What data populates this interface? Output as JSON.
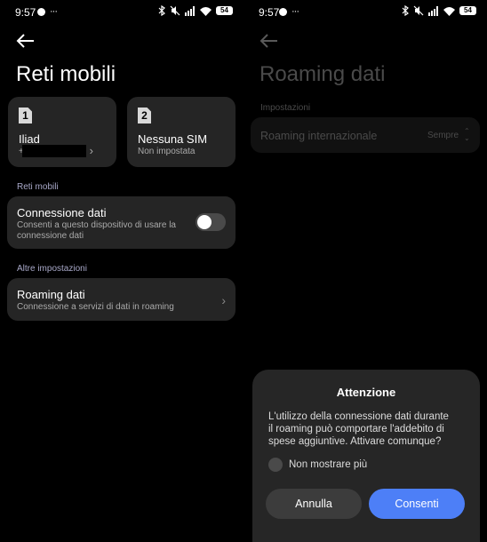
{
  "status": {
    "time": "9:57",
    "dots": "···",
    "battery": "54"
  },
  "left": {
    "title": "Reti mobili",
    "sims": [
      {
        "num": "1",
        "name": "Iliad",
        "sub": "+",
        "chevron": "›"
      },
      {
        "num": "2",
        "name": "Nessuna SIM",
        "sub": "Non impostata"
      }
    ],
    "section1": "Reti mobili",
    "data_conn": {
      "title": "Connessione dati",
      "desc_line1": "Consenti a questo dispositivo di usare la",
      "desc_line2": "connessione dati"
    },
    "section2": "Altre impostazioni",
    "roaming": {
      "title": "Roaming dati",
      "desc": "Connessione a servizi di dati in roaming",
      "chevron": "›"
    }
  },
  "right": {
    "title": "Roaming dati",
    "section": "Impostazioni",
    "intl": {
      "label": "Roaming internazionale",
      "value": "Sempre",
      "arrows": "⌃⌄"
    },
    "dialog": {
      "title": "Attenzione",
      "body_line1": "L'utilizzo della connessione dati durante",
      "body_line2": "il roaming può comportare l'addebito di",
      "body_line3": "spese aggiuntive. Attivare comunque?",
      "checkbox": "Non mostrare più",
      "cancel": "Annulla",
      "ok": "Consenti"
    }
  },
  "colors": {
    "accent": "#4d7ff7",
    "card": "#252525",
    "dialog": "#262626"
  }
}
